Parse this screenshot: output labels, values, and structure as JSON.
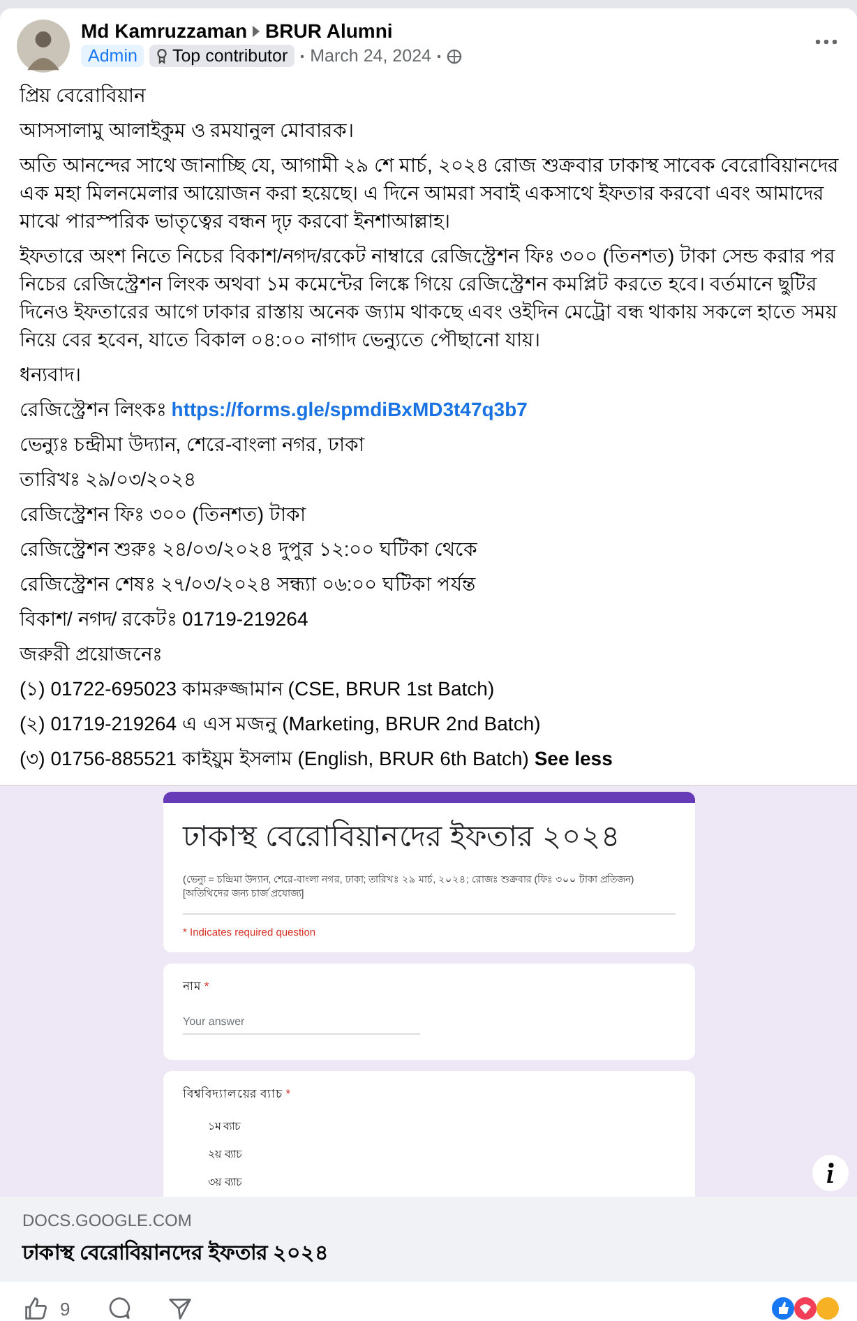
{
  "post": {
    "author": "Md Kamruzzaman",
    "group": "BRUR Alumni",
    "badges": [
      {
        "label": "Admin",
        "kind": "role"
      },
      {
        "label": "Top contributor",
        "kind": "contributor"
      }
    ],
    "date": "March 24, 2024",
    "paragraphs": [
      {
        "text": "প্রিয় বেরোবিয়ান"
      },
      {
        "text": "আসসালামু আলাইকুম ও রমযানুল মোবারক।"
      },
      {
        "text": "অতি আনন্দের সাথে জানাচ্ছি যে, আগামী ২৯ শে মার্চ, ২০২৪ রোজ শুক্রবার ঢাকাস্থ সাবেক বেরোবিয়ানদের এক মহা মিলনমেলার আয়োজন করা হয়েছে। এ দিনে আমরা সবাই একসাথে ইফতার করবো এবং আমাদের মাঝে পারস্পরিক ভাতৃত্বের বন্ধন দৃঢ় করবো ইনশাআল্লাহ।"
      },
      {
        "text": "ইফতারে অংশ নিতে নিচের বিকাশ/নগদ/রকেট নাম্বারে রেজিস্ট্রেশন ফিঃ ৩০০ (তিনশত) টাকা সেন্ড করার পর নিচের রেজিস্ট্রেশন লিংক অথবা ১ম কমেন্টের লিঙ্কে গিয়ে রেজিস্ট্রেশন কমপ্লিট করতে হবে। বর্তমানে ছুটির দিনেও ইফতারের আগে ঢাকার রাস্তায় অনেক জ্যাম থাকছে এবং ওইদিন মেট্রো বন্ধ থাকায় সকলে হাতে সময় নিয়ে বের হবেন, যাতে বিকাল ০৪:০০ নাগাদ ভেন্যুতে পৌছানো যায়।"
      },
      {
        "text": "ধন্যবাদ।"
      },
      {
        "text": "রেজিস্ট্রেশন লিংকঃ",
        "link": "https://forms.gle/spmdiBxMD3t47q3b7"
      },
      {
        "text": "ভেন্যুঃ চন্দ্রীমা উদ্যান, শেরে-বাংলা নগর, ঢাকা"
      },
      {
        "text": "তারিখঃ ২৯/০৩/২০২৪"
      },
      {
        "text": "রেজিস্ট্রেশন ফিঃ ৩০০ (তিনশত) টাকা"
      },
      {
        "text": "রেজিস্ট্রেশন শুরুঃ ২৪/০৩/২০২৪ দুপুর ১২:০০ ঘটিকা থেকে"
      },
      {
        "text": "রেজিস্ট্রেশন শেষঃ ২৭/০৩/২০২৪ সন্ধ্যা ০৬:০০ ঘটিকা পর্যন্ত"
      },
      {
        "text": "বিকাশ/ নগদ/ রকেটঃ 01719-219264"
      },
      {
        "text": "জরুরী প্রয়োজনেঃ"
      },
      {
        "text": "(১) 01722-695023 কামরুজ্জামান (CSE, BRUR 1st Batch)"
      },
      {
        "text": "(২) 01719-219264 এ এস মজনু (Marketing, BRUR 2nd Batch)"
      },
      {
        "text": "(৩) 01756-885521 কাইয়ুম ইসলাম (English, BRUR 6th Batch)",
        "more": "See less"
      }
    ],
    "preview": {
      "form_title": "ঢাকাস্থ বেরোবিয়ানদের ইফতার ২০২৪",
      "form_description": "(ভেন্যু = চন্দ্রিমা উদ্যান, শেরে-বাংলা নগর, ঢাকা; তারিখঃ ২৯ মার্চ, ২০২৪; রোজঃ শুক্রবার (ফিঃ ৩০০ টাকা প্রতিজন) [অতিথিদের জন্য চার্জ প্রযোজ্য]",
      "required_note": "* Indicates required question",
      "questions": [
        {
          "kind": "text",
          "label": "নাম",
          "required": "*",
          "placeholder": "Your answer"
        },
        {
          "kind": "choice",
          "label": "বিশ্ববিদ্যালয়ের ব্যাচ",
          "required": "*",
          "options": [
            "১ম ব্যাচ",
            "২য় ব্যাচ",
            "৩য় ব্যাচ"
          ]
        }
      ],
      "domain": "DOCS.GOOGLE.COM",
      "link_title": "ঢাকাস্থ বেরোবিয়ানদের ইফতার ২০২৪"
    },
    "like_count": "9"
  }
}
